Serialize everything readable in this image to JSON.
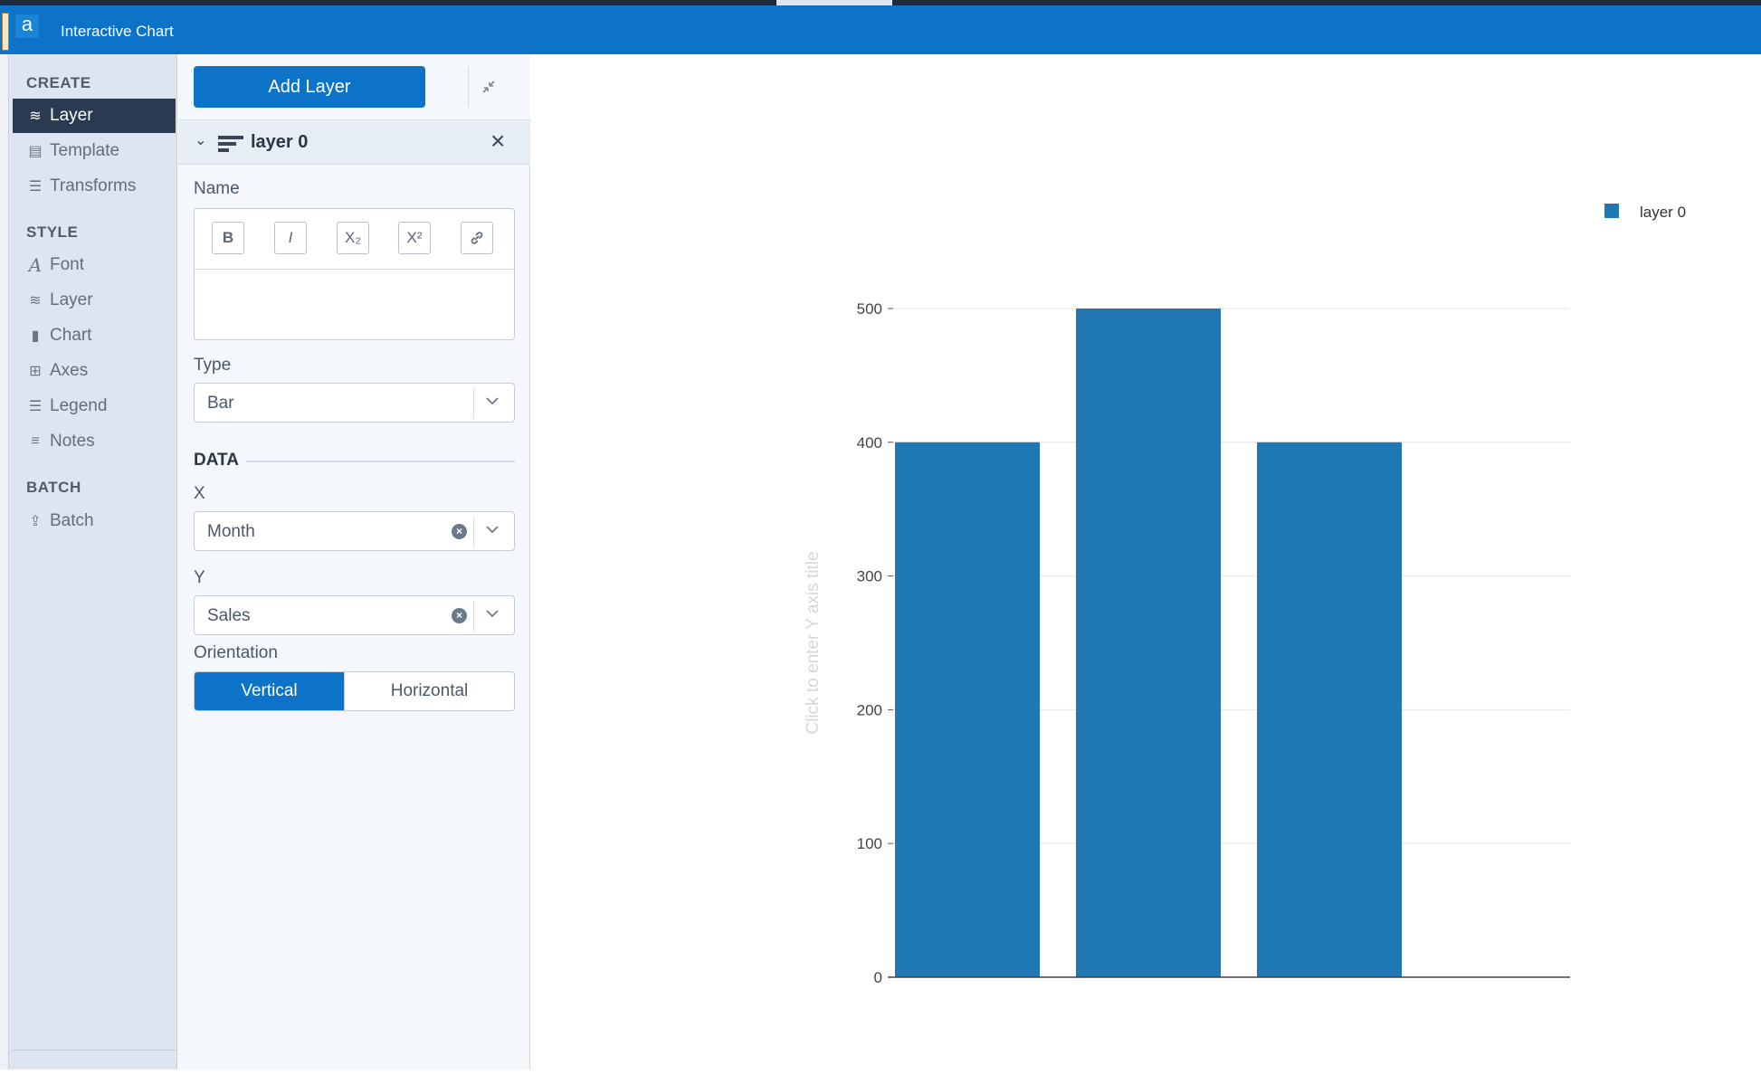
{
  "window": {
    "logo_letter": "a",
    "title": "Interactive Chart"
  },
  "sidebar": {
    "sections": [
      {
        "title": "CREATE",
        "items": [
          {
            "label": "Layer",
            "icon": "layers-icon",
            "active": true
          },
          {
            "label": "Template",
            "icon": "template-icon"
          },
          {
            "label": "Transforms",
            "icon": "list-icon"
          }
        ]
      },
      {
        "title": "STYLE",
        "items": [
          {
            "label": "Font",
            "icon": "font-icon"
          },
          {
            "label": "Layer",
            "icon": "layers-icon"
          },
          {
            "label": "Chart",
            "icon": "bar-chart-icon"
          },
          {
            "label": "Axes",
            "icon": "grid-icon"
          },
          {
            "label": "Legend",
            "icon": "list-icon"
          },
          {
            "label": "Notes",
            "icon": "notes-icon"
          }
        ]
      },
      {
        "title": "BATCH",
        "items": [
          {
            "label": "Batch",
            "icon": "batch-icon"
          }
        ]
      }
    ]
  },
  "panel": {
    "add_layer_label": "Add Layer",
    "layer_name": "layer 0",
    "name_label": "Name",
    "format_buttons": [
      "B",
      "I",
      "X₂",
      "X²",
      "🔗"
    ],
    "type_label": "Type",
    "type_value": "Bar",
    "data_title": "DATA",
    "x_label": "X",
    "x_value": "Month",
    "y_label": "Y",
    "y_value": "Sales",
    "orientation_label": "Orientation",
    "orientation_options": [
      "Vertical",
      "Horizontal"
    ],
    "orientation_selected": "Vertical"
  },
  "chart_data": {
    "type": "bar",
    "categories": [
      "",
      "",
      ""
    ],
    "series": [
      {
        "name": "layer 0",
        "values": [
          400,
          500,
          400
        ],
        "color": "#1f77b4"
      }
    ],
    "ylabel": "Click to enter Y axis title",
    "ylim": [
      0,
      500
    ],
    "yticks": [
      0,
      100,
      200,
      300,
      400,
      500
    ],
    "grid": true,
    "legend": "top-right"
  }
}
